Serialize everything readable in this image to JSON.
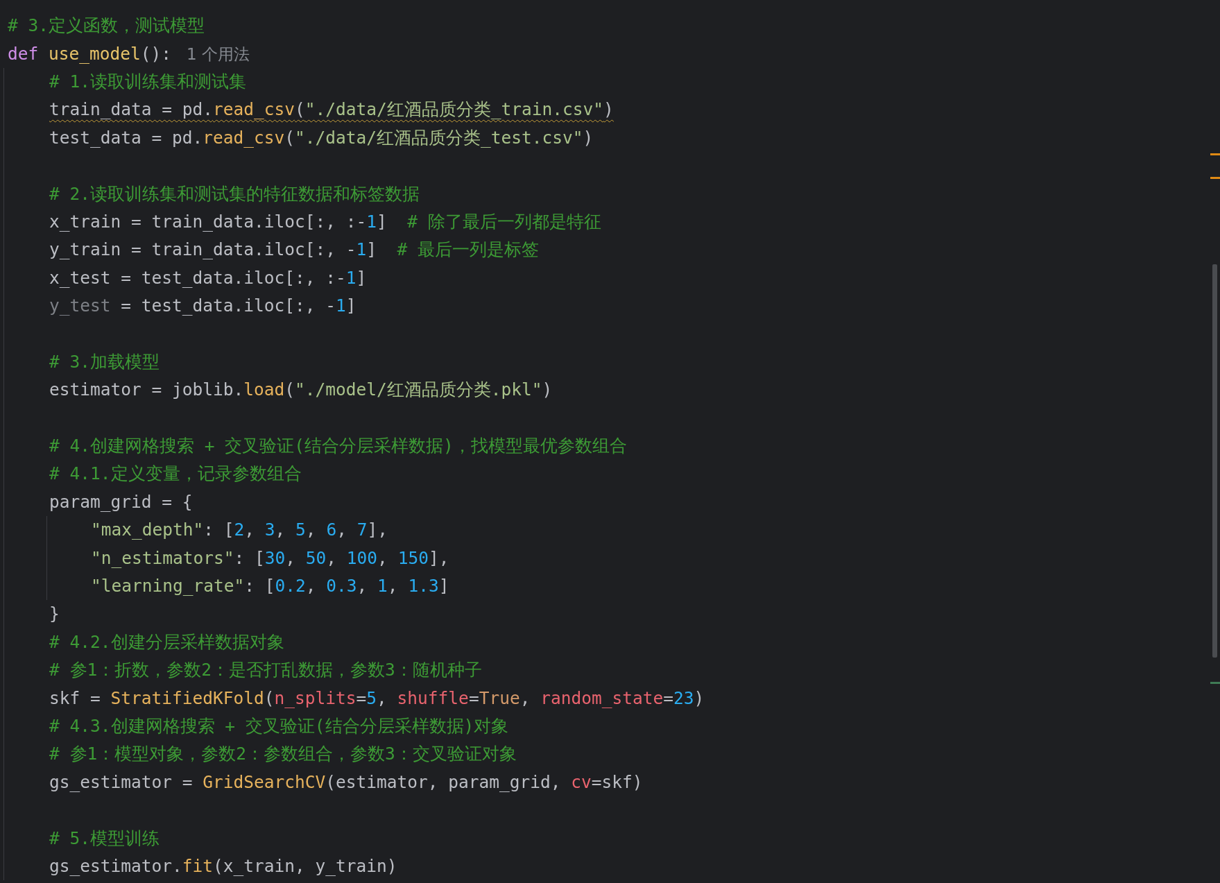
{
  "editor": {
    "lines": [
      {
        "kind": "code",
        "tokens": [
          {
            "text": "# 3.定义函数，测试模型",
            "kind": "comment"
          }
        ]
      },
      {
        "kind": "code",
        "tokens": [
          {
            "text": "def ",
            "kind": "keyword"
          },
          {
            "text": "use_model",
            "kind": "defname"
          },
          {
            "text": "():",
            "kind": "plain"
          }
        ],
        "hint": "1 个用法",
        "children": [
          {
            "kind": "code",
            "tokens": [
              {
                "text": "# 1.读取训练集和测试集",
                "kind": "comment"
              }
            ]
          },
          {
            "kind": "code",
            "warning": true,
            "tokens": [
              {
                "text": "train_data = pd.",
                "kind": "plain"
              },
              {
                "text": "read_csv",
                "kind": "call"
              },
              {
                "text": "(",
                "kind": "plain"
              },
              {
                "text": "\"./data/红酒品质分类_train.csv\"",
                "kind": "string"
              },
              {
                "text": ")",
                "kind": "plain"
              }
            ]
          },
          {
            "kind": "code",
            "warning": false,
            "tokens": [
              {
                "text": "test_data = pd.",
                "kind": "plain"
              },
              {
                "text": "read_csv",
                "kind": "call"
              },
              {
                "text": "(",
                "kind": "plain"
              },
              {
                "text": "\"./data/红酒品质分类_test.csv\"",
                "kind": "string"
              },
              {
                "text": ")",
                "kind": "plain"
              }
            ]
          },
          {
            "kind": "blank"
          },
          {
            "kind": "code",
            "tokens": [
              {
                "text": "# 2.读取训练集和测试集的特征数据和标签数据",
                "kind": "comment"
              }
            ]
          },
          {
            "kind": "code",
            "tokens": [
              {
                "text": "x_train = train_data.iloc[:, :-",
                "kind": "plain"
              },
              {
                "text": "1",
                "kind": "number"
              },
              {
                "text": "]  ",
                "kind": "plain"
              },
              {
                "text": "# 除了最后一列都是特征",
                "kind": "comment"
              }
            ]
          },
          {
            "kind": "code",
            "tokens": [
              {
                "text": "y_train = train_data.iloc[:, -",
                "kind": "plain"
              },
              {
                "text": "1",
                "kind": "number"
              },
              {
                "text": "]  ",
                "kind": "plain"
              },
              {
                "text": "# 最后一列是标签",
                "kind": "comment"
              }
            ]
          },
          {
            "kind": "code",
            "tokens": [
              {
                "text": "x_test = test_data.iloc[:, :-",
                "kind": "plain"
              },
              {
                "text": "1",
                "kind": "number"
              },
              {
                "text": "]",
                "kind": "plain"
              }
            ]
          },
          {
            "kind": "code",
            "tokens": [
              {
                "text": "y_test",
                "kind": "unused"
              },
              {
                "text": " = test_data.iloc[:, -",
                "kind": "plain"
              },
              {
                "text": "1",
                "kind": "number"
              },
              {
                "text": "]",
                "kind": "plain"
              }
            ]
          },
          {
            "kind": "blank"
          },
          {
            "kind": "code",
            "tokens": [
              {
                "text": "# 3.加载模型",
                "kind": "comment"
              }
            ]
          },
          {
            "kind": "code",
            "tokens": [
              {
                "text": "estimator = joblib.",
                "kind": "plain"
              },
              {
                "text": "load",
                "kind": "call"
              },
              {
                "text": "(",
                "kind": "plain"
              },
              {
                "text": "\"./model/红酒品质分类.pkl\"",
                "kind": "string"
              },
              {
                "text": ")",
                "kind": "plain"
              }
            ]
          },
          {
            "kind": "blank"
          },
          {
            "kind": "code",
            "tokens": [
              {
                "text": "# 4.创建网格搜索 + 交叉验证(结合分层采样数据)，找模型最优参数组合",
                "kind": "comment"
              }
            ]
          },
          {
            "kind": "code",
            "tokens": [
              {
                "text": "# 4.1.定义变量，记录参数组合",
                "kind": "comment"
              }
            ]
          },
          {
            "kind": "code",
            "tokens": [
              {
                "text": "param_grid = {",
                "kind": "plain"
              }
            ],
            "children": [
              {
                "kind": "code",
                "tokens": [
                  {
                    "text": "\"max_depth\"",
                    "kind": "string"
                  },
                  {
                    "text": ": [",
                    "kind": "plain"
                  },
                  {
                    "text": "2",
                    "kind": "number"
                  },
                  {
                    "text": ", ",
                    "kind": "plain"
                  },
                  {
                    "text": "3",
                    "kind": "number"
                  },
                  {
                    "text": ", ",
                    "kind": "plain"
                  },
                  {
                    "text": "5",
                    "kind": "number"
                  },
                  {
                    "text": ", ",
                    "kind": "plain"
                  },
                  {
                    "text": "6",
                    "kind": "number"
                  },
                  {
                    "text": ", ",
                    "kind": "plain"
                  },
                  {
                    "text": "7",
                    "kind": "number"
                  },
                  {
                    "text": "],",
                    "kind": "plain"
                  }
                ]
              },
              {
                "kind": "code",
                "tokens": [
                  {
                    "text": "\"n_estimators\"",
                    "kind": "string"
                  },
                  {
                    "text": ": [",
                    "kind": "plain"
                  },
                  {
                    "text": "30",
                    "kind": "number"
                  },
                  {
                    "text": ", ",
                    "kind": "plain"
                  },
                  {
                    "text": "50",
                    "kind": "number"
                  },
                  {
                    "text": ", ",
                    "kind": "plain"
                  },
                  {
                    "text": "100",
                    "kind": "number"
                  },
                  {
                    "text": ", ",
                    "kind": "plain"
                  },
                  {
                    "text": "150",
                    "kind": "number"
                  },
                  {
                    "text": "],",
                    "kind": "plain"
                  }
                ]
              },
              {
                "kind": "code",
                "tokens": [
                  {
                    "text": "\"learning_rate\"",
                    "kind": "string"
                  },
                  {
                    "text": ": [",
                    "kind": "plain"
                  },
                  {
                    "text": "0.2",
                    "kind": "number"
                  },
                  {
                    "text": ", ",
                    "kind": "plain"
                  },
                  {
                    "text": "0.3",
                    "kind": "number"
                  },
                  {
                    "text": ", ",
                    "kind": "plain"
                  },
                  {
                    "text": "1",
                    "kind": "number"
                  },
                  {
                    "text": ", ",
                    "kind": "plain"
                  },
                  {
                    "text": "1.3",
                    "kind": "number"
                  },
                  {
                    "text": "]",
                    "kind": "plain"
                  }
                ]
              }
            ]
          },
          {
            "kind": "code",
            "tokens": [
              {
                "text": "}",
                "kind": "plain"
              }
            ]
          },
          {
            "kind": "code",
            "tokens": [
              {
                "text": "# 4.2.创建分层采样数据对象",
                "kind": "comment"
              }
            ]
          },
          {
            "kind": "code",
            "tokens": [
              {
                "text": "# 参1：折数，参数2：是否打乱数据，参数3：随机种子",
                "kind": "comment"
              }
            ]
          },
          {
            "kind": "code",
            "tokens": [
              {
                "text": "skf = ",
                "kind": "plain"
              },
              {
                "text": "StratifiedKFold",
                "kind": "call"
              },
              {
                "text": "(",
                "kind": "plain"
              },
              {
                "text": "n_splits",
                "kind": "param"
              },
              {
                "text": "=",
                "kind": "plain"
              },
              {
                "text": "5",
                "kind": "number"
              },
              {
                "text": ", ",
                "kind": "plain"
              },
              {
                "text": "shuffle",
                "kind": "param"
              },
              {
                "text": "=",
                "kind": "plain"
              },
              {
                "text": "True",
                "kind": "constant"
              },
              {
                "text": ", ",
                "kind": "plain"
              },
              {
                "text": "random_state",
                "kind": "param"
              },
              {
                "text": "=",
                "kind": "plain"
              },
              {
                "text": "23",
                "kind": "number"
              },
              {
                "text": ")",
                "kind": "plain"
              }
            ]
          },
          {
            "kind": "code",
            "tokens": [
              {
                "text": "# 4.3.创建网格搜索 + 交叉验证(结合分层采样数据)对象",
                "kind": "comment"
              }
            ]
          },
          {
            "kind": "code",
            "tokens": [
              {
                "text": "# 参1：模型对象，参数2：参数组合，参数3：交叉验证对象",
                "kind": "comment"
              }
            ]
          },
          {
            "kind": "code",
            "tokens": [
              {
                "text": "gs_estimator = ",
                "kind": "plain"
              },
              {
                "text": "GridSearchCV",
                "kind": "call"
              },
              {
                "text": "(estimator, param_grid, ",
                "kind": "plain"
              },
              {
                "text": "cv",
                "kind": "param"
              },
              {
                "text": "=skf)",
                "kind": "plain"
              }
            ]
          },
          {
            "kind": "blank"
          },
          {
            "kind": "code",
            "tokens": [
              {
                "text": "# 5.模型训练",
                "kind": "comment"
              }
            ]
          },
          {
            "kind": "code",
            "tokens": [
              {
                "text": "gs_estimator.",
                "kind": "plain"
              },
              {
                "text": "fit",
                "kind": "call"
              },
              {
                "text": "(x_train, y_train)",
                "kind": "plain"
              }
            ]
          }
        ]
      }
    ]
  }
}
